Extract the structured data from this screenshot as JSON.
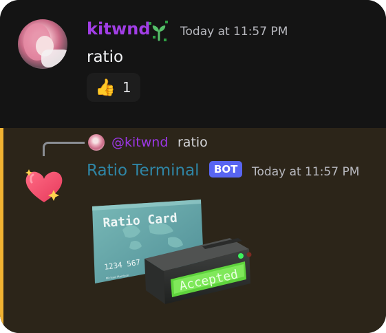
{
  "message_1": {
    "username": "kitwnd",
    "timestamp": "Today at 11:57 PM",
    "content": "ratio",
    "reaction": {
      "emoji": "👍",
      "count": "1"
    }
  },
  "message_2": {
    "reply": {
      "mention": "@kitwnd",
      "text": "ratio"
    },
    "username": "Ratio Terminal",
    "bot_badge": "BOT",
    "timestamp": "Today at 11:57 PM",
    "image": {
      "card_title": "Ratio Card",
      "card_number": "1234 567",
      "card_holder": "Michael Morrison",
      "terminal_screen": "Accepted"
    }
  },
  "colors": {
    "background_top": "#141414",
    "background_bottom": "#2c2519",
    "accent_bar": "#f0b232",
    "username_kitwnd": "#a23ee6",
    "username_ratio_terminal": "#2f86a6",
    "bot_badge": "#5865f2",
    "timestamp": "#b8b9bf",
    "terminal_screen": "#66dd44"
  }
}
